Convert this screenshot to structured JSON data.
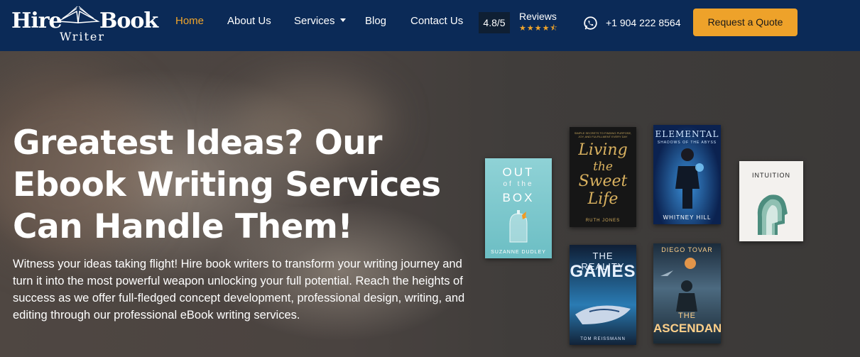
{
  "brand": {
    "word1": "Hire",
    "word2": "Book",
    "word3": "Writer"
  },
  "nav": {
    "items": [
      {
        "label": "Home",
        "active": true
      },
      {
        "label": "About Us"
      },
      {
        "label": "Services",
        "dropdown": true
      },
      {
        "label": "Blog"
      },
      {
        "label": "Contact Us"
      }
    ],
    "rating": "4.8/5",
    "reviews_label": "Reviews",
    "stars": "★★★★⯪",
    "phone": "+1 904 222 8564",
    "cta": "Request a Quote"
  },
  "hero": {
    "heading": "Greatest Ideas? Our Ebook Writing Services Can Handle Them!",
    "description": "Witness your ideas taking flight! Hire book writers to transform your writing journey and turn it into the most powerful weapon unlocking your full potential. Reach the heights of success as we offer full-fledged concept development, professional design, writing, and editing through our professional eBook writing services."
  },
  "books": [
    {
      "title1": "OUT",
      "title2": "of the",
      "title3": "BOX",
      "author": "SUZANNE DUDLEY"
    },
    {
      "tagline": "SIMPLE SECRETS TO FINDING PURPOSE, JOY, AND FULFILLMENT EVERY DAY",
      "title1": "Living",
      "title2": "the",
      "title3": "Sweet",
      "title4": "Life",
      "author": "RUTH JONES"
    },
    {
      "title1": "ELEMENTAL",
      "subtitle": "SHADOWS OF THE ABYSS",
      "author": "WHITNEY HILL"
    },
    {
      "title1": "INTUITION"
    },
    {
      "title1": "THE REALITY",
      "title2": "GAMES",
      "author": "TOM REISSMANN"
    },
    {
      "author": "DIEGO TOVAR",
      "title1": "THE",
      "title2": "ASCENDANTS"
    }
  ],
  "colors": {
    "navbar": "#0b2a57",
    "accent": "#eea22a",
    "active_link": "#f0a52b"
  },
  "icons": {
    "phone": "whatsapp-icon",
    "dropdown": "chevron-down-icon"
  }
}
